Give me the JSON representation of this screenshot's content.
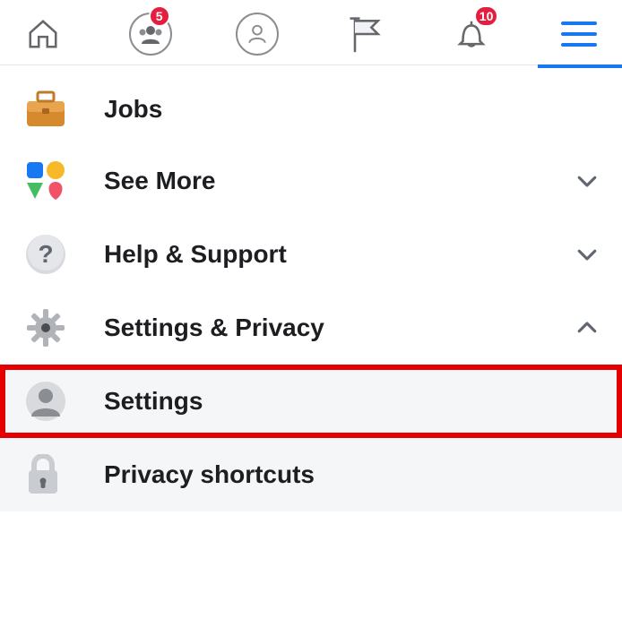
{
  "topbar": {
    "groups_badge": "5",
    "notifications_badge": "10"
  },
  "menu": {
    "jobs": "Jobs",
    "see_more": "See More",
    "help_support": "Help & Support",
    "settings_privacy": "Settings & Privacy",
    "settings": "Settings",
    "privacy_shortcuts": "Privacy shortcuts"
  },
  "colors": {
    "accent": "#1877f2",
    "badge": "#e41e3f",
    "highlight": "#e40000"
  }
}
